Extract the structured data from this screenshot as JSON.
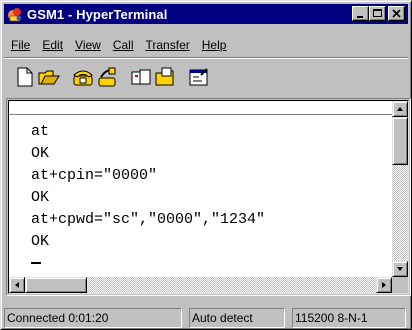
{
  "window": {
    "title": "GSM1 - HyperTerminal"
  },
  "menu": [
    {
      "label": "File"
    },
    {
      "label": "Edit"
    },
    {
      "label": "View"
    },
    {
      "label": "Call"
    },
    {
      "label": "Transfer"
    },
    {
      "label": "Help"
    }
  ],
  "toolbar": {
    "icons": [
      "new-icon",
      "open-icon",
      "connect-icon",
      "disconnect-icon",
      "send-icon",
      "receive-icon",
      "properties-icon"
    ]
  },
  "terminal": {
    "lines": [
      "at",
      "OK",
      "at+cpin=\"0000\"",
      "OK",
      "at+cpwd=\"sc\",\"0000\",\"1234\"",
      "OK"
    ]
  },
  "status": {
    "connection": "Connected 0:01:20",
    "detect": "Auto detect",
    "settings": "115200 8-N-1"
  },
  "colors": {
    "titlebar": "#000080",
    "face": "#c0c0c0"
  }
}
